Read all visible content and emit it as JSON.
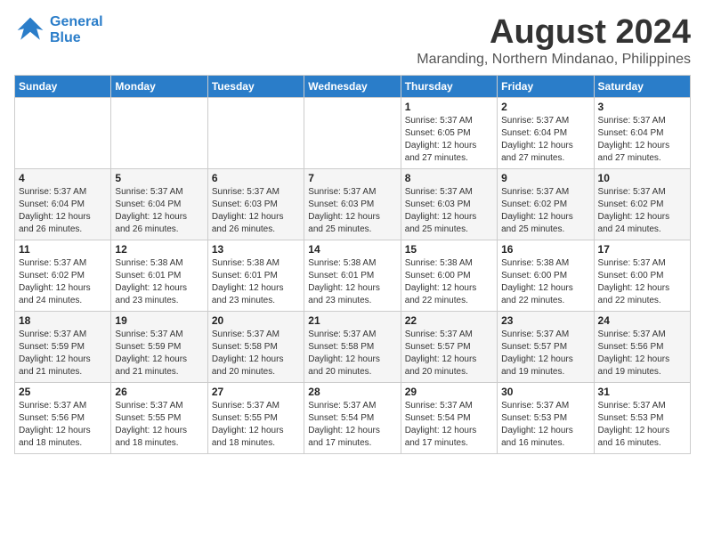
{
  "logo": {
    "line1": "General",
    "line2": "Blue"
  },
  "title": "August 2024",
  "location": "Maranding, Northern Mindanao, Philippines",
  "weekdays": [
    "Sunday",
    "Monday",
    "Tuesday",
    "Wednesday",
    "Thursday",
    "Friday",
    "Saturday"
  ],
  "weeks": [
    [
      {
        "day": "",
        "detail": ""
      },
      {
        "day": "",
        "detail": ""
      },
      {
        "day": "",
        "detail": ""
      },
      {
        "day": "",
        "detail": ""
      },
      {
        "day": "1",
        "detail": "Sunrise: 5:37 AM\nSunset: 6:05 PM\nDaylight: 12 hours\nand 27 minutes."
      },
      {
        "day": "2",
        "detail": "Sunrise: 5:37 AM\nSunset: 6:04 PM\nDaylight: 12 hours\nand 27 minutes."
      },
      {
        "day": "3",
        "detail": "Sunrise: 5:37 AM\nSunset: 6:04 PM\nDaylight: 12 hours\nand 27 minutes."
      }
    ],
    [
      {
        "day": "4",
        "detail": "Sunrise: 5:37 AM\nSunset: 6:04 PM\nDaylight: 12 hours\nand 26 minutes."
      },
      {
        "day": "5",
        "detail": "Sunrise: 5:37 AM\nSunset: 6:04 PM\nDaylight: 12 hours\nand 26 minutes."
      },
      {
        "day": "6",
        "detail": "Sunrise: 5:37 AM\nSunset: 6:03 PM\nDaylight: 12 hours\nand 26 minutes."
      },
      {
        "day": "7",
        "detail": "Sunrise: 5:37 AM\nSunset: 6:03 PM\nDaylight: 12 hours\nand 25 minutes."
      },
      {
        "day": "8",
        "detail": "Sunrise: 5:37 AM\nSunset: 6:03 PM\nDaylight: 12 hours\nand 25 minutes."
      },
      {
        "day": "9",
        "detail": "Sunrise: 5:37 AM\nSunset: 6:02 PM\nDaylight: 12 hours\nand 25 minutes."
      },
      {
        "day": "10",
        "detail": "Sunrise: 5:37 AM\nSunset: 6:02 PM\nDaylight: 12 hours\nand 24 minutes."
      }
    ],
    [
      {
        "day": "11",
        "detail": "Sunrise: 5:37 AM\nSunset: 6:02 PM\nDaylight: 12 hours\nand 24 minutes."
      },
      {
        "day": "12",
        "detail": "Sunrise: 5:38 AM\nSunset: 6:01 PM\nDaylight: 12 hours\nand 23 minutes."
      },
      {
        "day": "13",
        "detail": "Sunrise: 5:38 AM\nSunset: 6:01 PM\nDaylight: 12 hours\nand 23 minutes."
      },
      {
        "day": "14",
        "detail": "Sunrise: 5:38 AM\nSunset: 6:01 PM\nDaylight: 12 hours\nand 23 minutes."
      },
      {
        "day": "15",
        "detail": "Sunrise: 5:38 AM\nSunset: 6:00 PM\nDaylight: 12 hours\nand 22 minutes."
      },
      {
        "day": "16",
        "detail": "Sunrise: 5:38 AM\nSunset: 6:00 PM\nDaylight: 12 hours\nand 22 minutes."
      },
      {
        "day": "17",
        "detail": "Sunrise: 5:37 AM\nSunset: 6:00 PM\nDaylight: 12 hours\nand 22 minutes."
      }
    ],
    [
      {
        "day": "18",
        "detail": "Sunrise: 5:37 AM\nSunset: 5:59 PM\nDaylight: 12 hours\nand 21 minutes."
      },
      {
        "day": "19",
        "detail": "Sunrise: 5:37 AM\nSunset: 5:59 PM\nDaylight: 12 hours\nand 21 minutes."
      },
      {
        "day": "20",
        "detail": "Sunrise: 5:37 AM\nSunset: 5:58 PM\nDaylight: 12 hours\nand 20 minutes."
      },
      {
        "day": "21",
        "detail": "Sunrise: 5:37 AM\nSunset: 5:58 PM\nDaylight: 12 hours\nand 20 minutes."
      },
      {
        "day": "22",
        "detail": "Sunrise: 5:37 AM\nSunset: 5:57 PM\nDaylight: 12 hours\nand 20 minutes."
      },
      {
        "day": "23",
        "detail": "Sunrise: 5:37 AM\nSunset: 5:57 PM\nDaylight: 12 hours\nand 19 minutes."
      },
      {
        "day": "24",
        "detail": "Sunrise: 5:37 AM\nSunset: 5:56 PM\nDaylight: 12 hours\nand 19 minutes."
      }
    ],
    [
      {
        "day": "25",
        "detail": "Sunrise: 5:37 AM\nSunset: 5:56 PM\nDaylight: 12 hours\nand 18 minutes."
      },
      {
        "day": "26",
        "detail": "Sunrise: 5:37 AM\nSunset: 5:55 PM\nDaylight: 12 hours\nand 18 minutes."
      },
      {
        "day": "27",
        "detail": "Sunrise: 5:37 AM\nSunset: 5:55 PM\nDaylight: 12 hours\nand 18 minutes."
      },
      {
        "day": "28",
        "detail": "Sunrise: 5:37 AM\nSunset: 5:54 PM\nDaylight: 12 hours\nand 17 minutes."
      },
      {
        "day": "29",
        "detail": "Sunrise: 5:37 AM\nSunset: 5:54 PM\nDaylight: 12 hours\nand 17 minutes."
      },
      {
        "day": "30",
        "detail": "Sunrise: 5:37 AM\nSunset: 5:53 PM\nDaylight: 12 hours\nand 16 minutes."
      },
      {
        "day": "31",
        "detail": "Sunrise: 5:37 AM\nSunset: 5:53 PM\nDaylight: 12 hours\nand 16 minutes."
      }
    ]
  ]
}
